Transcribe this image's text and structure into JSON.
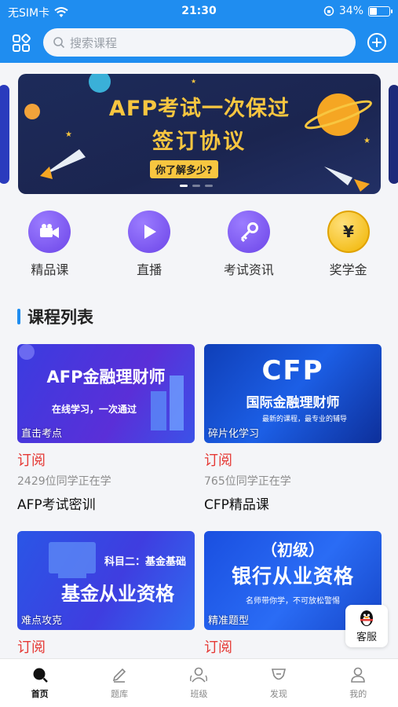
{
  "status_bar": {
    "carrier": "无SIM卡",
    "time": "21:30",
    "battery": "34%",
    "battery_level": 0.34
  },
  "search": {
    "placeholder": "搜索课程"
  },
  "banner": {
    "line1": "AFP考试一次保过",
    "line2": "签订协议",
    "pill": "你了解多少?",
    "slide_count": 3,
    "active_slide": 0
  },
  "categories": [
    {
      "label": "精品课",
      "icon": "video-camera-icon",
      "color": "#7b5cf0"
    },
    {
      "label": "直播",
      "icon": "play-icon",
      "color": "#7b5cf0"
    },
    {
      "label": "考试资讯",
      "icon": "key-icon",
      "color": "#7b5cf0"
    },
    {
      "label": "奖学金",
      "icon": "yen-coin-icon",
      "color": "#f5c518"
    }
  ],
  "section": {
    "title": "课程列表"
  },
  "courses": [
    {
      "banner_title": "AFP金融理财师",
      "banner_sub": "在线学习，一次通过",
      "tag": "直击考点",
      "subscribe": "订阅",
      "count": "2429位同学正在学",
      "name": "AFP考试密训"
    },
    {
      "banner_title": "CFP",
      "banner_sub": "国际金融理财师",
      "banner_note": "最新的课程，最专业的辅导",
      "tag": "碎片化学习",
      "subscribe": "订阅",
      "count": "765位同学正在学",
      "name": "CFP精品课"
    },
    {
      "banner_title": "基金从业资格",
      "banner_sub": "科目二：基金基础",
      "tag": "难点攻克",
      "subscribe": "订阅"
    },
    {
      "banner_title": "银行从业资格",
      "banner_sub": "（初级）",
      "banner_note": "名师带你学，不可放松警惕",
      "tag": "精准题型",
      "subscribe": "订阅"
    }
  ],
  "service": {
    "label": "客服"
  },
  "tabs": [
    {
      "label": "首页",
      "icon": "search-home-icon",
      "active": true
    },
    {
      "label": "题库",
      "icon": "pencil-icon",
      "active": false
    },
    {
      "label": "班级",
      "icon": "users-icon",
      "active": false
    },
    {
      "label": "发现",
      "icon": "discover-icon",
      "active": false
    },
    {
      "label": "我的",
      "icon": "user-icon",
      "active": false
    }
  ],
  "colors": {
    "primary": "#1f8df0",
    "accent_red": "#e53935",
    "gold": "#f8c640"
  }
}
